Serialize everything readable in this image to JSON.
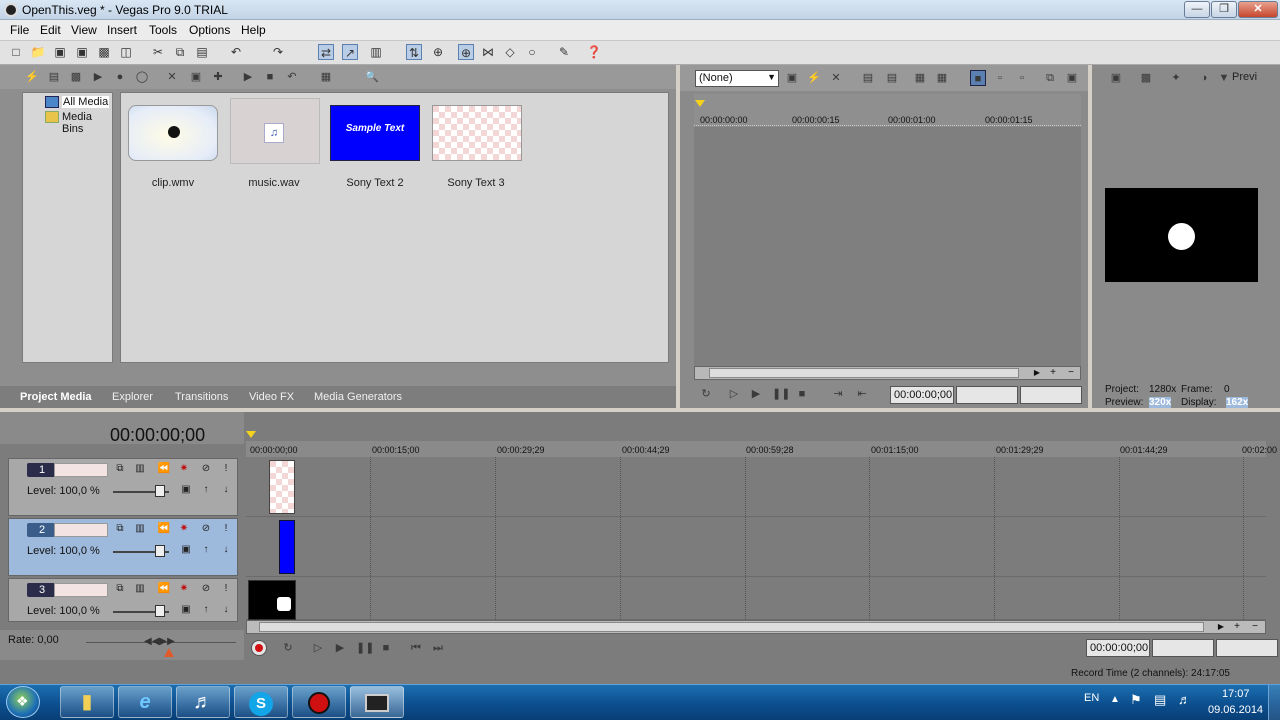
{
  "window": {
    "title": "OpenThis.veg * - Vegas Pro 9.0 TRIAL",
    "minimize": "—",
    "maximize": "❐",
    "close": "✕"
  },
  "menu": [
    "File",
    "Edit",
    "View",
    "Insert",
    "Tools",
    "Options",
    "Help"
  ],
  "media": {
    "tree": [
      "All Media",
      "Media Bins"
    ],
    "items": [
      {
        "label": "clip.wmv"
      },
      {
        "label": "music.wav"
      },
      {
        "label": "Sony Text 2",
        "thumb_text": "Sample Text"
      },
      {
        "label": "Sony Text 3"
      }
    ],
    "tabs": [
      "Project Media",
      "Explorer",
      "Transitions",
      "Video FX",
      "Media Generators"
    ]
  },
  "trimmer": {
    "select_value": "(None)",
    "ruler": [
      "00:00:00:00",
      "00:00:00:15",
      "00:00:01:00",
      "00:00:01:15"
    ],
    "time": "00:00:00;00"
  },
  "preview": {
    "label": "Previ",
    "project_label": "Project:",
    "project_value": "1280x",
    "frame_label": "Frame:",
    "frame_value": "0",
    "preview_label": "Preview:",
    "preview_value": "320x",
    "display_label": "Display:",
    "display_value": "162x"
  },
  "timeline": {
    "timecode": "00:00:00;00",
    "ruler": [
      "00:00:00;00",
      "00:00:15;00",
      "00:00:29;29",
      "00:00:44;29",
      "00:00:59;28",
      "00:01:15;00",
      "00:01:29;29",
      "00:01:44;29",
      "00:02:00"
    ],
    "tracks": [
      {
        "num": "1",
        "level": "Level: 100,0 %"
      },
      {
        "num": "2",
        "level": "Level: 100,0 %"
      },
      {
        "num": "3",
        "level": "Level: 100,0 %"
      }
    ],
    "rate": "Rate: 0,00",
    "time": "00:00:00;00",
    "record_time": "Record Time (2 channels): 24:17:05"
  },
  "taskbar": {
    "lang": "EN",
    "clock_time": "17:07",
    "clock_date": "09.06.2014"
  },
  "colors": {
    "accent": "#0000ff",
    "record": "#d01010"
  }
}
